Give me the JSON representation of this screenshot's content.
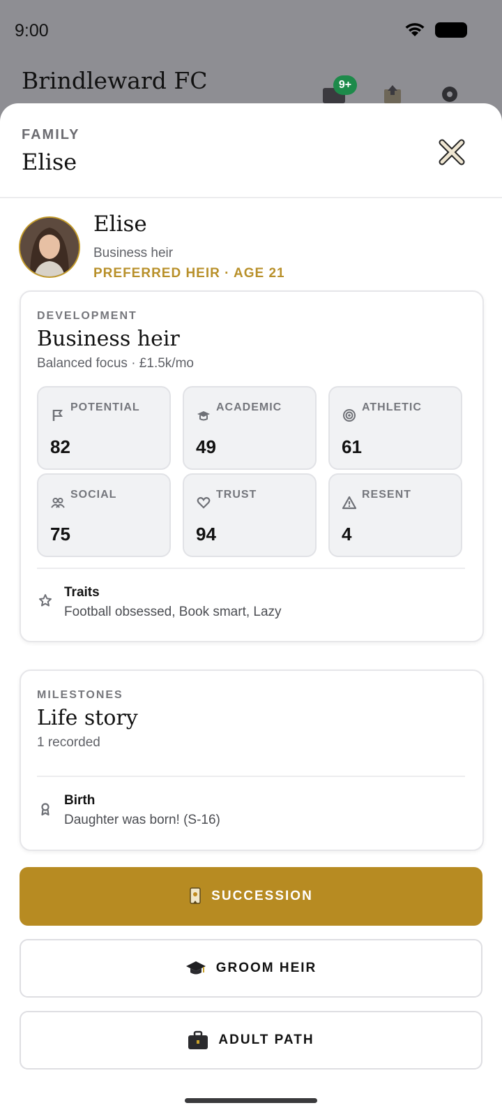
{
  "status_bar": {
    "time": "9:00"
  },
  "header": {
    "title": "Brindleward FC",
    "badge": "9+"
  },
  "sheet": {
    "kicker": "FAMILY",
    "title": "Elise"
  },
  "profile": {
    "name": "Elise",
    "role": "Business heir",
    "meta": "PREFERRED HEIR · AGE 21"
  },
  "development": {
    "kicker": "DEVELOPMENT",
    "title": "Business heir",
    "subtitle": "Balanced focus · £1.5k/mo",
    "stats": [
      {
        "label": "POTENTIAL",
        "value": "82",
        "icon": "flag-icon"
      },
      {
        "label": "ACADEMIC",
        "value": "49",
        "icon": "graduation-cap-icon"
      },
      {
        "label": "ATHLETIC",
        "value": "61",
        "icon": "target-icon"
      },
      {
        "label": "SOCIAL",
        "value": "75",
        "icon": "people-icon"
      },
      {
        "label": "TRUST",
        "value": "94",
        "icon": "heart-icon"
      },
      {
        "label": "RESENT",
        "value": "4",
        "icon": "warning-icon"
      }
    ],
    "traits": {
      "title": "Traits",
      "value": "Football obsessed, Book smart, Lazy"
    }
  },
  "milestones": {
    "kicker": "MILESTONES",
    "title": "Life story",
    "subtitle": "1 recorded",
    "items": [
      {
        "title": "Birth",
        "desc": "Daughter was born! (S-16)"
      }
    ]
  },
  "actions": {
    "succession": "SUCCESSION",
    "groom": "GROOM HEIR",
    "adult": "ADULT PATH"
  },
  "colors": {
    "accent": "#b78b22",
    "badge": "#1d8a4a"
  }
}
